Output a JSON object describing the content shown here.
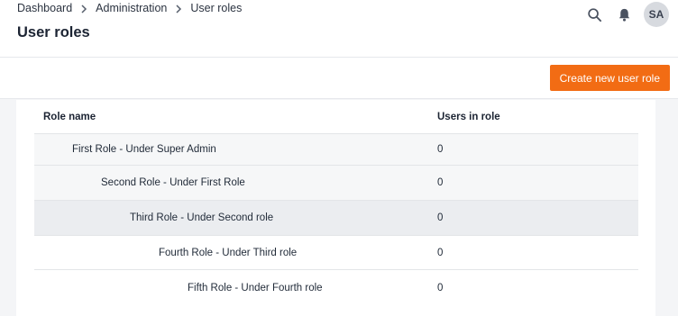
{
  "breadcrumb": {
    "items": [
      "Dashboard",
      "Administration",
      "User roles"
    ]
  },
  "page": {
    "title": "User roles"
  },
  "header_icons": {
    "search": "search-icon",
    "notifications": "bell-icon"
  },
  "user": {
    "initials": "SA"
  },
  "toolbar": {
    "create_label": "Create new user role"
  },
  "table": {
    "columns": [
      "Role name",
      "Users in role"
    ],
    "rows": [
      {
        "name": "First Role - Under Super Admin",
        "users": "0"
      },
      {
        "name": "Second Role - Under First Role",
        "users": "0"
      },
      {
        "name": "Third Role - Under Second role",
        "users": "0"
      },
      {
        "name": "Fourth Role - Under Third role",
        "users": "0"
      },
      {
        "name": "Fifth Role - Under Fourth role",
        "users": "0"
      }
    ]
  },
  "colors": {
    "accent": "#f26c14",
    "row_alt": "#f6f7f8",
    "row_hover": "#ebedf0"
  }
}
